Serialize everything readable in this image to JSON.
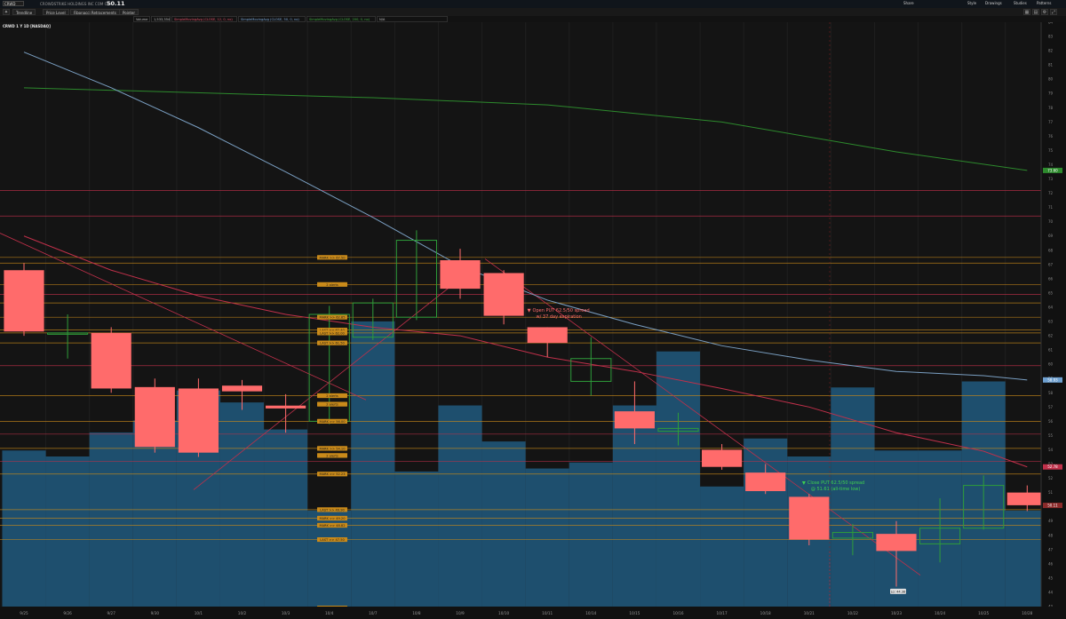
{
  "header": {
    "symbol": "CRWD",
    "description": "CROWDSTRIKE HOLDINGS INC COM CL A",
    "price": "50.11",
    "buttons": [
      "Share",
      "Drawings",
      "Studies",
      "Patterns",
      "Style"
    ]
  },
  "toolbar": {
    "items": [
      "Trendline",
      "Price Level",
      "Fibonacci Retracements",
      "Pointer"
    ]
  },
  "studies": [
    "Volume",
    "1,533,354",
    "SimpleMovingAvg (CLOSE, 12, 0, no)",
    "SimpleMovingAvg (CLOSE, 50, 0, no)",
    "SimpleMovingAvg (CLOSE, 200, 0, no)",
    "N/A"
  ],
  "chart_title": "CRWD 1 Y 1D [NASDAQ]",
  "colors": {
    "up": "#2e9c3a",
    "down": "#ff6b6b",
    "volume": "#1e4f6e",
    "ma_fast": "#c0304a",
    "ma_mid": "#7a9fc2",
    "ma_slow": "#2d8a2d",
    "label_bg": "#c98a1a"
  },
  "chart_data": {
    "type": "candlestick",
    "price_ylim": [
      43,
      84
    ],
    "candles": [
      {
        "x": "9/25",
        "o": 66.6,
        "h": 67.1,
        "l": 62.0,
        "c": 62.3
      },
      {
        "x": "9/26",
        "o": 62.2,
        "h": 63.5,
        "l": 60.4,
        "c": 62.2
      },
      {
        "x": "9/27",
        "o": 62.2,
        "h": 62.6,
        "l": 58.0,
        "c": 58.3
      },
      {
        "x": "9/30",
        "o": 58.4,
        "h": 59.0,
        "l": 53.8,
        "c": 54.2
      },
      {
        "x": "10/1",
        "o": 58.3,
        "h": 59.0,
        "l": 53.5,
        "c": 53.8
      },
      {
        "x": "10/2",
        "o": 58.5,
        "h": 58.9,
        "l": 56.8,
        "c": 58.1
      },
      {
        "x": "10/3",
        "o": 57.1,
        "h": 57.9,
        "l": 55.2,
        "c": 56.9
      },
      {
        "x": "10/4",
        "o": 56.0,
        "h": 64.1,
        "l": 55.8,
        "c": 63.5
      },
      {
        "x": "10/7",
        "o": 61.9,
        "h": 64.6,
        "l": 61.7,
        "c": 64.3
      },
      {
        "x": "10/8",
        "o": 63.3,
        "h": 69.4,
        "l": 63.1,
        "c": 68.7
      },
      {
        "x": "10/9",
        "o": 67.3,
        "h": 68.1,
        "l": 64.6,
        "c": 65.3
      },
      {
        "x": "10/10",
        "o": 66.4,
        "h": 66.6,
        "l": 62.8,
        "c": 63.4
      },
      {
        "x": "10/11",
        "o": 62.6,
        "h": 62.6,
        "l": 60.5,
        "c": 61.5
      },
      {
        "x": "10/14",
        "o": 58.8,
        "h": 61.9,
        "l": 57.8,
        "c": 60.4
      },
      {
        "x": "10/15",
        "o": 56.7,
        "h": 58.8,
        "l": 54.4,
        "c": 55.5
      },
      {
        "x": "10/16",
        "o": 55.3,
        "h": 56.6,
        "l": 54.3,
        "c": 55.5
      },
      {
        "x": "10/17",
        "o": 54.0,
        "h": 54.4,
        "l": 52.6,
        "c": 52.8
      },
      {
        "x": "10/18",
        "o": 52.4,
        "h": 53.0,
        "l": 50.9,
        "c": 51.1
      },
      {
        "x": "10/21",
        "o": 50.7,
        "h": 50.9,
        "l": 47.3,
        "c": 47.7
      },
      {
        "x": "10/22",
        "o": 47.8,
        "h": 48.8,
        "l": 46.6,
        "c": 48.2
      },
      {
        "x": "10/23",
        "o": 48.1,
        "h": 49.0,
        "l": 44.4,
        "c": 46.9
      },
      {
        "x": "10/24",
        "o": 47.4,
        "h": 50.6,
        "l": 46.1,
        "c": 48.5
      },
      {
        "x": "10/25",
        "o": 48.5,
        "h": 52.2,
        "l": 48.4,
        "c": 51.5
      },
      {
        "x": "10/28",
        "o": 51.0,
        "h": 51.5,
        "l": 49.7,
        "c": 50.11
      }
    ],
    "volume": [
      0.52,
      0.5,
      0.58,
      0.62,
      0.72,
      0.68,
      0.59,
      0.32,
      0.95,
      0.45,
      0.67,
      0.55,
      0.46,
      0.48,
      0.67,
      0.85,
      0.4,
      0.56,
      0.5,
      0.73,
      0.52,
      0.52,
      0.75,
      0.32
    ],
    "ma_slow": [
      [
        0,
        79.4
      ],
      [
        8,
        78.7
      ],
      [
        12,
        78.2
      ],
      [
        16,
        77.0
      ],
      [
        20,
        74.9
      ],
      [
        23,
        73.6
      ]
    ],
    "ma_mid": [
      [
        0,
        81.9
      ],
      [
        2,
        79.4
      ],
      [
        4,
        76.6
      ],
      [
        6,
        73.5
      ],
      [
        8,
        70.3
      ],
      [
        10,
        66.9
      ],
      [
        12,
        64.5
      ],
      [
        14,
        62.8
      ],
      [
        16,
        61.3
      ],
      [
        18,
        60.3
      ],
      [
        20,
        59.5
      ],
      [
        22,
        59.2
      ],
      [
        23,
        58.9
      ]
    ],
    "ma_fast": [
      [
        0,
        69.0
      ],
      [
        2,
        66.6
      ],
      [
        4,
        64.8
      ],
      [
        6,
        63.5
      ],
      [
        8,
        62.6
      ],
      [
        10,
        62.0
      ],
      [
        12,
        60.5
      ],
      [
        14,
        59.5
      ],
      [
        16,
        58.3
      ],
      [
        18,
        57.0
      ],
      [
        20,
        55.2
      ],
      [
        22,
        53.9
      ],
      [
        23,
        52.8
      ]
    ],
    "hlines": [
      {
        "y": 72.2,
        "c": "#c0304a"
      },
      {
        "y": 70.4,
        "c": "#c0304a"
      },
      {
        "y": 67.5,
        "c": "#c98a1a"
      },
      {
        "y": 67.1,
        "c": "#c98a1a"
      },
      {
        "y": 65.6,
        "c": "#c98a1a"
      },
      {
        "y": 64.9,
        "c": "#c0304a"
      },
      {
        "y": 64.3,
        "c": "#c98a1a"
      },
      {
        "y": 63.3,
        "c": "#c98a1a"
      },
      {
        "y": 62.4,
        "c": "#c98a1a"
      },
      {
        "y": 62.2,
        "c": "#c98a1a"
      },
      {
        "y": 61.5,
        "c": "#c98a1a"
      },
      {
        "y": 59.9,
        "c": "#c0304a"
      },
      {
        "y": 57.8,
        "c": "#c98a1a"
      },
      {
        "y": 56.0,
        "c": "#c98a1a"
      },
      {
        "y": 55.1,
        "c": "#c0304a"
      },
      {
        "y": 54.1,
        "c": "#c98a1a"
      },
      {
        "y": 53.2,
        "c": "#c0304a"
      },
      {
        "y": 52.3,
        "c": "#c98a1a"
      },
      {
        "y": 49.8,
        "c": "#c98a1a"
      },
      {
        "y": 49.2,
        "c": "#c98a1a"
      },
      {
        "y": 48.7,
        "c": "#c98a1a"
      },
      {
        "y": 47.7,
        "c": "#c98a1a"
      },
      {
        "y": 42.9,
        "c": "#c98a1a"
      }
    ],
    "level_labels": [
      {
        "text": "MARK >> 67.50",
        "y": 67.5
      },
      {
        "text": "2 alerts",
        "y": 65.6
      },
      {
        "text": "MARK >> 62.85",
        "y": 63.3
      },
      {
        "text": "LAST >> 62.40",
        "y": 62.4
      },
      {
        "text": "LAST >> 62.00",
        "y": 62.2
      },
      {
        "text": "LAST >> 61.50",
        "y": 61.5
      },
      {
        "text": "2 alerts",
        "y": 57.8
      },
      {
        "text": "2 alerts",
        "y": 57.2
      },
      {
        "text": "MARK >> 56.00",
        "y": 56.0
      },
      {
        "text": "MARK >> 54.10",
        "y": 54.1
      },
      {
        "text": "2 alerts",
        "y": 53.6
      },
      {
        "text": "MARK >> 52.23",
        "y": 52.3
      },
      {
        "text": "LAST >> 49.90",
        "y": 49.8
      },
      {
        "text": "MARK >> 49.20",
        "y": 49.2
      },
      {
        "text": "MARK >> 48.82",
        "y": 48.7
      },
      {
        "text": "LAST >> 47.50",
        "y": 47.7
      },
      {
        "text": "LAST >> 43.00",
        "y": 42.9
      }
    ],
    "right_labels": [
      {
        "text": "73.60",
        "y": 73.6,
        "c": "#2d8a2d"
      },
      {
        "text": "58.93",
        "y": 58.9,
        "c": "#6ea0d0"
      },
      {
        "text": "52.78",
        "y": 52.8,
        "c": "#c0304a"
      },
      {
        "text": "50.11",
        "y": 50.1,
        "c": "#8a2a2a"
      }
    ],
    "annotations": [
      {
        "text": "Open PUT 62.5/50 spread",
        "text2": "w/ 37 day expiration",
        "x": 11.6,
        "y": 63.7,
        "c": "#ff6b6b"
      },
      {
        "text": "Close PUT 62.5/50 spread",
        "text2": "@ 51.61 (all-time low)",
        "x": 17.9,
        "y": 51.6,
        "c": "#3fd04f"
      }
    ],
    "low_label": "Lo: 44.38",
    "y_ticks": [
      "84",
      "83",
      "82",
      "81",
      "80",
      "79",
      "78",
      "77",
      "76",
      "75",
      "74",
      "73",
      "72",
      "71",
      "70",
      "69",
      "68",
      "67",
      "66",
      "65",
      "64",
      "63",
      "62",
      "61",
      "60",
      "59",
      "58",
      "57",
      "56",
      "55",
      "54",
      "53",
      "52",
      "51",
      "50",
      "49",
      "48",
      "47",
      "46",
      "45",
      "44",
      "43"
    ]
  }
}
